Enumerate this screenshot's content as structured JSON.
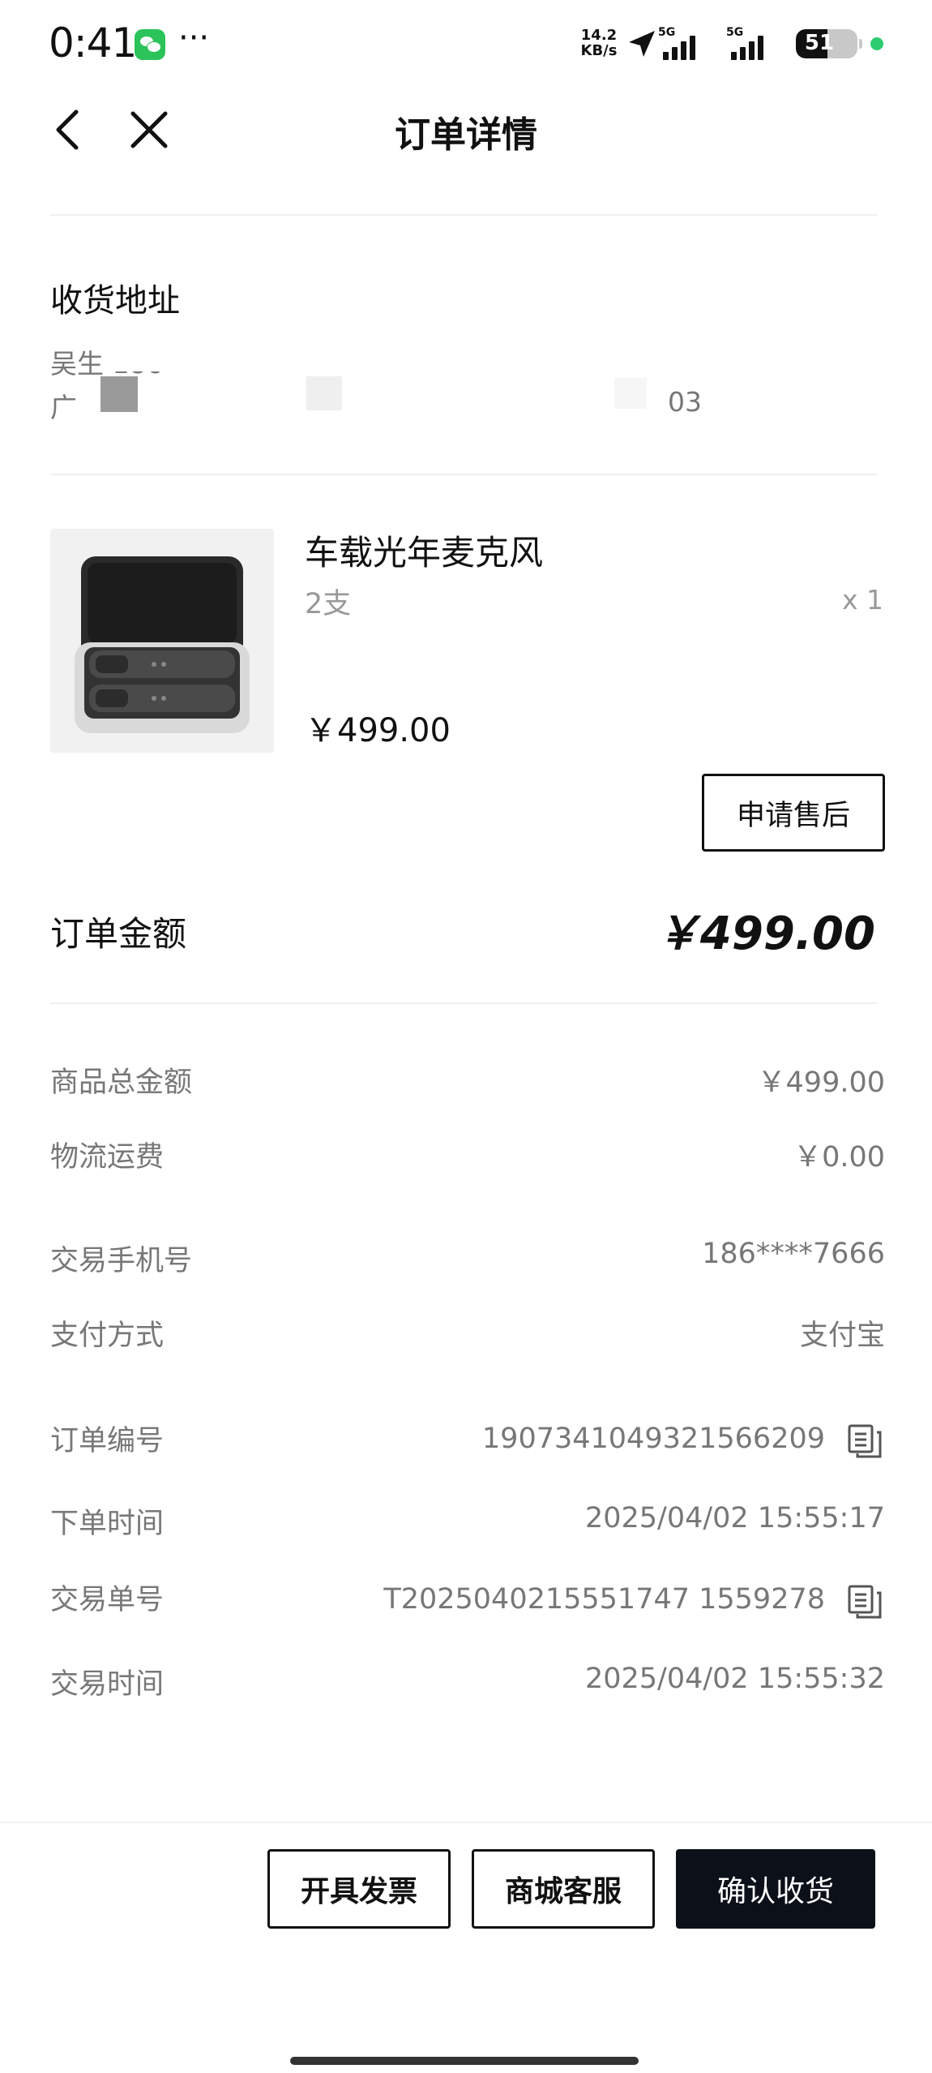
{
  "status_bar": {
    "time": "0:41",
    "dots": "···",
    "net_speed_value": "14.2",
    "net_speed_unit": "KB/s",
    "sim1_label": "5G",
    "sim2_label": "5G",
    "battery_level": "51"
  },
  "header": {
    "title": "订单详情"
  },
  "address": {
    "title": "收货地址",
    "line1_visible": "吴生  186*",
    "line2_visible_start": "广",
    "line2_visible_end": "03"
  },
  "product": {
    "name": "车载光年麦克风",
    "spec": "2支",
    "quantity": "x 1",
    "price": "￥499.00",
    "after_sale_label": "申请售后"
  },
  "order_total": {
    "label": "订单金额",
    "value": "￥499.00"
  },
  "details": [
    {
      "label": "商品总金额",
      "value": "￥499.00"
    },
    {
      "label": "物流运费",
      "value": "￥0.00"
    },
    {
      "label": "交易手机号",
      "value": "186****7666"
    },
    {
      "label": "支付方式",
      "value": "支付宝"
    },
    {
      "label": "订单编号",
      "value": "1907341049321566209"
    },
    {
      "label": "下单时间",
      "value": "2025/04/02 15:55:17"
    },
    {
      "label": "交易单号",
      "value": "T2025040215551747 1559278"
    },
    {
      "label": "交易时间",
      "value": "2025/04/02 15:55:32"
    }
  ],
  "actions": {
    "invoice_label": "开具发票",
    "service_label": "商城客服",
    "confirm_label": "确认收货"
  },
  "colors": {
    "primary_button": "#0c1119",
    "status_green": "#2ecc71",
    "wechat_green": "#2bc35a"
  }
}
